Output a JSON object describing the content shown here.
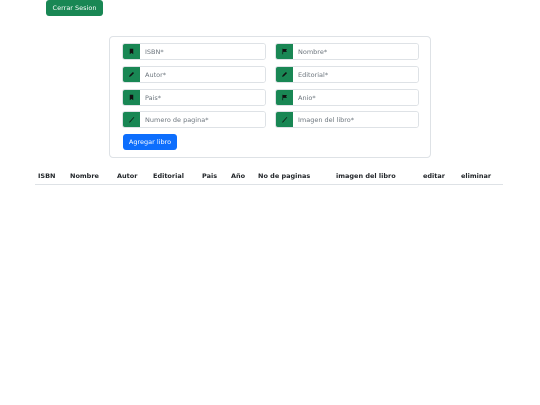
{
  "header": {
    "logout_label": "Cerrar Sesion"
  },
  "form": {
    "fields": [
      {
        "placeholder": "ISBN*",
        "icon": "bookmark-icon"
      },
      {
        "placeholder": "Nombre*",
        "icon": "flag-icon"
      },
      {
        "placeholder": "Autor*",
        "icon": "pencil-icon"
      },
      {
        "placeholder": "Editorial*",
        "icon": "pencil-icon"
      },
      {
        "placeholder": "Pais*",
        "icon": "bookmark-icon"
      },
      {
        "placeholder": "Anio*",
        "icon": "flag-icon"
      },
      {
        "placeholder": "Numero de pagina*",
        "icon": "check-icon"
      },
      {
        "placeholder": "Imagen del libro*",
        "icon": "check-icon"
      }
    ],
    "submit_label": "Agregar libro"
  },
  "table": {
    "columns": [
      "ISBN",
      "Nombre",
      "Autor",
      "Editorial",
      "Pais",
      "Año",
      "No de paginas",
      "imagen del libro",
      "editar",
      "eliminar"
    ],
    "rows": []
  },
  "colors": {
    "success": "#198754",
    "primary": "#0d6efd",
    "border": "#dee2e6"
  }
}
